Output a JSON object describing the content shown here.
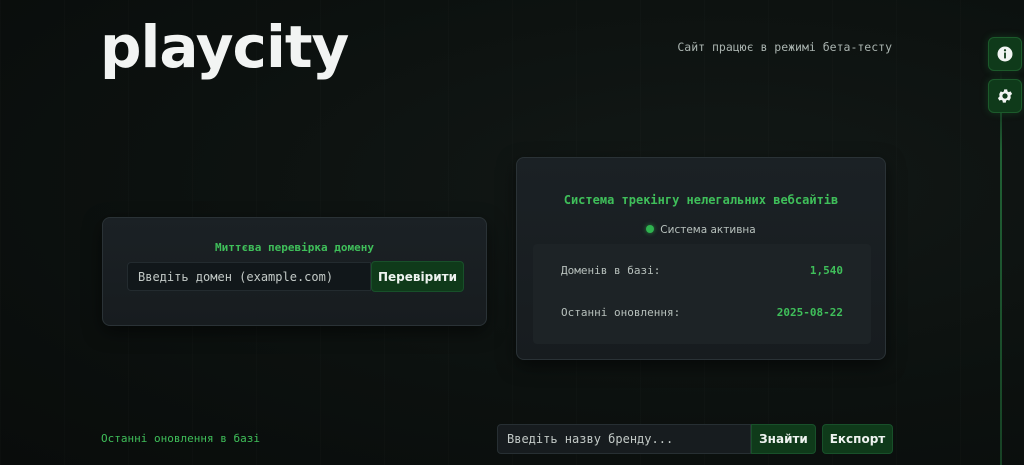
{
  "brand": {
    "logo_text": "playcity"
  },
  "header": {
    "beta_note": "Сайт працює в режимі бета-тесту"
  },
  "side_buttons": [
    {
      "icon": "info-icon"
    },
    {
      "icon": "gear-icon"
    }
  ],
  "domain_check": {
    "title": "Миттєва перевірка домену",
    "input_placeholder": "Введіть домен (example.com)",
    "input_value": "",
    "button_label": "Перевірити"
  },
  "tracker": {
    "title": "Система трекінгу нелегальних вебсайтів",
    "status_text": "Система активна",
    "stats": [
      {
        "label": "Доменів в базі:",
        "value": "1,540"
      },
      {
        "label": "Останні оновлення:",
        "value": "2025-08-22"
      }
    ]
  },
  "updates": {
    "label": "Останні оновлення в базі",
    "search_placeholder": "Введіть назву бренду...",
    "search_value": "",
    "find_label": "Знайти",
    "export_label": "Експорт"
  },
  "colors": {
    "accent_green": "#3fbf5a",
    "button_green": "#0f3a1a",
    "background": "#0b0f0e"
  }
}
